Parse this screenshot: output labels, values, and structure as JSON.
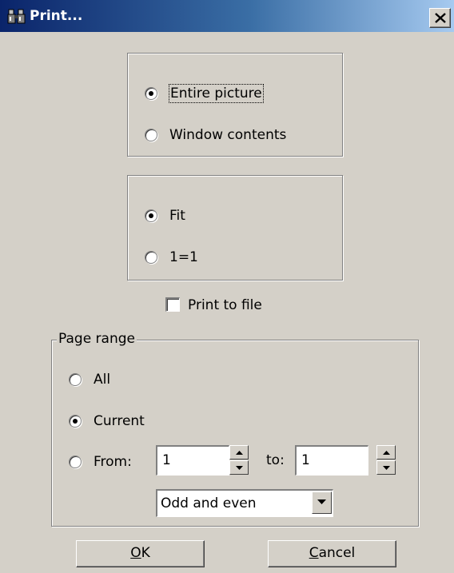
{
  "window": {
    "title": "Print...",
    "title_icon": "binoculars-icon",
    "close_icon": "close-icon"
  },
  "picture_group": {
    "options": [
      {
        "label": "Entire picture",
        "checked": true
      },
      {
        "label": "Window contents",
        "checked": false
      }
    ]
  },
  "scale_group": {
    "options": [
      {
        "label": "Fit",
        "checked": true
      },
      {
        "label": "1=1",
        "checked": false
      }
    ]
  },
  "print_to_file": {
    "label": "Print to file",
    "checked": false
  },
  "page_range": {
    "legend": "Page range",
    "options": [
      {
        "label": "All",
        "checked": false
      },
      {
        "label": "Current",
        "checked": true
      },
      {
        "label": "From:",
        "checked": false
      }
    ],
    "from_value": "1",
    "to_label": "to:",
    "to_value": "1",
    "parity": {
      "selected": "Odd and even"
    }
  },
  "buttons": {
    "ok": {
      "underlined": "O",
      "rest": "K"
    },
    "cancel": {
      "underlined": "C",
      "rest": "ancel"
    }
  }
}
